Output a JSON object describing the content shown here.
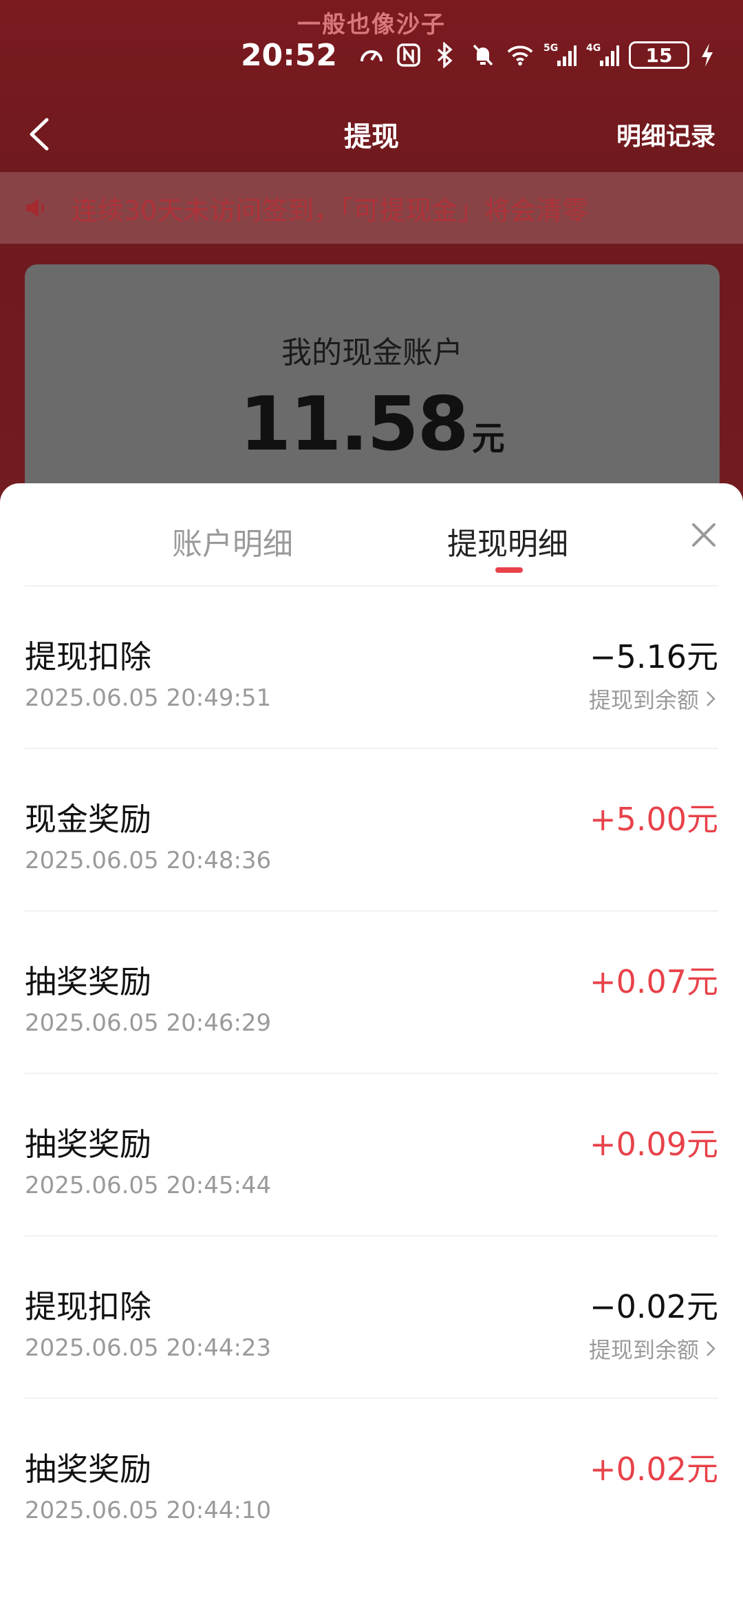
{
  "watermark": "一般也像沙子",
  "status_bar": {
    "time": "20:52",
    "battery": "15",
    "network_labels": [
      "5G",
      "4G"
    ]
  },
  "navbar": {
    "title": "提现",
    "right_link": "明细记录"
  },
  "notice": {
    "text": "连续30天未访问签到，「可提现金」将会清零"
  },
  "account_card": {
    "title": "我的现金账户",
    "amount": "11.58",
    "unit": "元"
  },
  "sheet": {
    "tabs": [
      {
        "label": "账户明细",
        "active": false
      },
      {
        "label": "提现明细",
        "active": true
      }
    ],
    "records": [
      {
        "title": "提现扣除",
        "time": "2025.06.05 20:49:51",
        "amount": "−5.16元",
        "positive": false,
        "sub": "提现到余额"
      },
      {
        "title": "现金奖励",
        "time": "2025.06.05 20:48:36",
        "amount": "+5.00元",
        "positive": true,
        "sub": ""
      },
      {
        "title": "抽奖奖励",
        "time": "2025.06.05 20:46:29",
        "amount": "+0.07元",
        "positive": true,
        "sub": ""
      },
      {
        "title": "抽奖奖励",
        "time": "2025.06.05 20:45:44",
        "amount": "+0.09元",
        "positive": true,
        "sub": ""
      },
      {
        "title": "提现扣除",
        "time": "2025.06.05 20:44:23",
        "amount": "−0.02元",
        "positive": false,
        "sub": "提现到余额"
      },
      {
        "title": "抽奖奖励",
        "time": "2025.06.05 20:44:10",
        "amount": "+0.02元",
        "positive": true,
        "sub": ""
      }
    ]
  },
  "colors": {
    "header_red": "#741c20",
    "accent_red": "#e8424a",
    "muted_text": "#9a9a9a"
  }
}
